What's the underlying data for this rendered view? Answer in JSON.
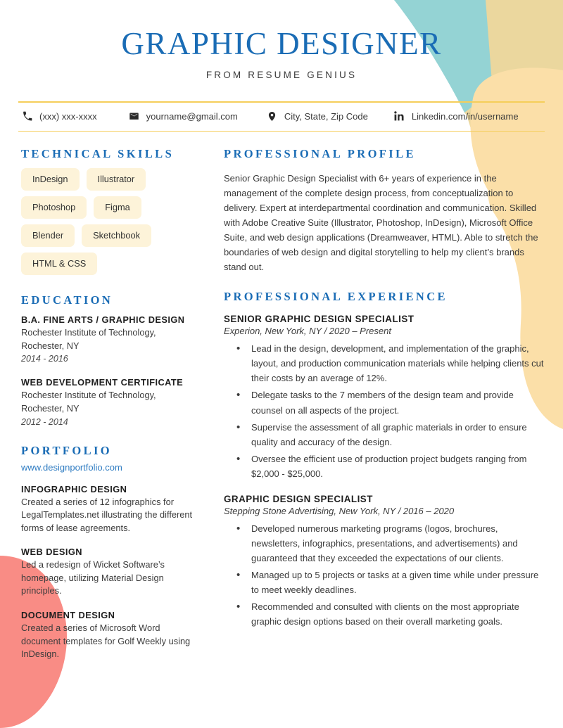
{
  "header": {
    "title": "GRAPHIC DESIGNER",
    "subtitle": "FROM RESUME GENIUS"
  },
  "contact": [
    {
      "icon": "phone-icon",
      "text": "(xxx) xxx-xxxx"
    },
    {
      "icon": "envelope-icon",
      "text": "yourname@gmail.com"
    },
    {
      "icon": "map-pin-icon",
      "text": "City, State, Zip Code"
    },
    {
      "icon": "linkedin-icon",
      "text": "Linkedin.com/in/username"
    }
  ],
  "left": {
    "skills_heading": "TECHNICAL SKILLS",
    "skills": [
      "InDesign",
      "Illustrator",
      "Photoshop",
      "Figma",
      "Blender",
      "Sketchbook",
      "HTML & CSS"
    ],
    "education_heading": "EDUCATION",
    "education": [
      {
        "degree": "B.A. FINE ARTS / GRAPHIC DESIGN",
        "school": "Rochester Institute of Technology,",
        "location": "Rochester, NY",
        "dates": "2014 - 2016"
      },
      {
        "degree": "WEB DEVELOPMENT CERTIFICATE",
        "school": "Rochester Institute of Technology,",
        "location": "Rochester, NY",
        "dates": "2012 - 2014"
      }
    ],
    "portfolio_heading": "PORTFOLIO",
    "portfolio_link": "www.designportfolio.com",
    "portfolio_items": [
      {
        "title": "INFOGRAPHIC DESIGN",
        "description": "Created a series of 12 infographics for LegalTemplates.net illustrating the different forms of lease agreements."
      },
      {
        "title": "WEB DESIGN",
        "description": "Led a redesign of Wicket Software’s homepage, utilizing Material Design principles."
      },
      {
        "title": "DOCUMENT DESIGN",
        "description": "Created a series of Microsoft Word document templates for Golf Weekly using InDesign."
      }
    ]
  },
  "right": {
    "profile_heading": "PROFESSIONAL PROFILE",
    "profile_text": "Senior Graphic Design Specialist with 6+ years of experience in the management of the complete design process, from conceptualization to delivery. Expert at interdepartmental coordination and communication. Skilled with Adobe Creative Suite (Illustrator, Photoshop, InDesign), Microsoft Office Suite, and web design applications (Dreamweaver, HTML). Able to stretch the boundaries of web design and digital storytelling to help my client’s brands stand out.",
    "experience_heading": "PROFESSIONAL EXPERIENCE",
    "jobs": [
      {
        "title": "SENIOR GRAPHIC DESIGN SPECIALIST",
        "meta": "Experion, New York, NY / 2020 – Present",
        "bullets": [
          "Lead in the design, development, and implementation of the graphic, layout, and production communication materials while helping clients cut their costs by an average of 12%.",
          "Delegate tasks to the 7 members of the design team and provide counsel on all aspects of the project.",
          "Supervise the assessment of all graphic materials in order to ensure quality and accuracy of the design.",
          "Oversee the efficient use of production project budgets ranging from $2,000 - $25,000."
        ]
      },
      {
        "title": "GRAPHIC DESIGN SPECIALIST",
        "meta": "Stepping Stone Advertising, New York, NY / 2016 – 2020",
        "bullets": [
          "Developed numerous marketing programs (logos, brochures, newsletters, infographics, presentations, and advertisements) and guaranteed that they exceeded the expectations of our clients.",
          "Managed up to 5 projects or tasks at a given time while under pressure to meet weekly deadlines.",
          "Recommended and consulted with clients on the most appropriate graphic design options based on their overall marketing goals."
        ]
      }
    ]
  },
  "colors": {
    "accent_blue": "#1a6cb5",
    "rule_yellow": "#f5ce5a",
    "pill_cream": "#fdf3d9",
    "shape_teal": "#94d3d4",
    "shape_khaki": "#ebd79e",
    "shape_orange": "#fbdfa8",
    "shape_coral": "#f98c85"
  }
}
